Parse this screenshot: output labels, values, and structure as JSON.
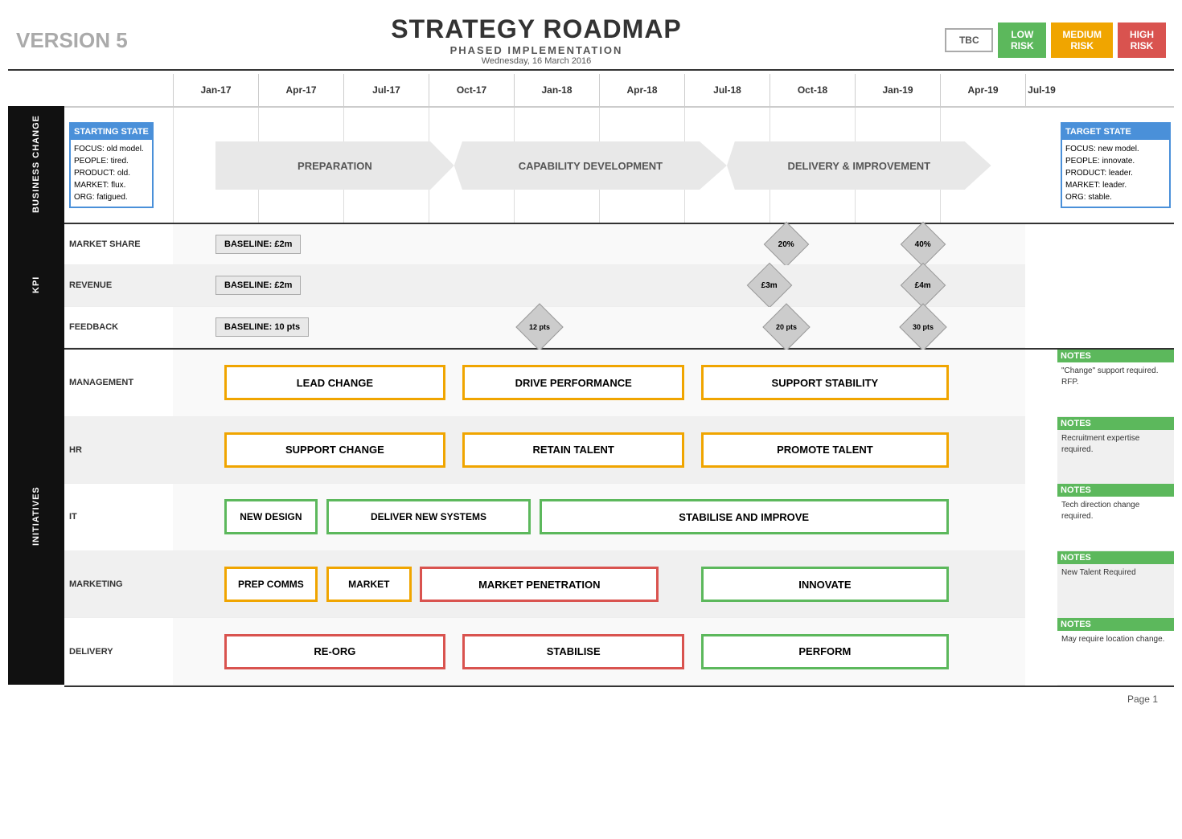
{
  "header": {
    "version": "VERSION 5",
    "title": "STRATEGY ROADMAP",
    "subtitle": "PHASED IMPLEMENTATION",
    "date": "Wednesday, 16 March 2016"
  },
  "badges": [
    {
      "label": "TBC",
      "class": "badge-tbc"
    },
    {
      "label": "LOW\nRISK",
      "class": "badge-low"
    },
    {
      "label": "MEDIUM\nRISK",
      "class": "badge-medium"
    },
    {
      "label": "HIGH\nRISK",
      "class": "badge-high"
    }
  ],
  "timeline": {
    "months": [
      "Jan-17",
      "Apr-17",
      "Jul-17",
      "Oct-17",
      "Jan-18",
      "Apr-18",
      "Jul-18",
      "Oct-18",
      "Jan-19",
      "Apr-19",
      "Jul-19"
    ]
  },
  "bc": {
    "label": "BUSINESS CHANGE",
    "starting_state": {
      "title": "STARTING STATE",
      "lines": [
        "FOCUS: old model.",
        "PEOPLE: tired.",
        "PRODUCT: old.",
        "MARKET: flux.",
        "ORG: fatigued."
      ]
    },
    "target_state": {
      "title": "TARGET STATE",
      "lines": [
        "FOCUS: new model.",
        "PEOPLE: innovate.",
        "PRODUCT: leader.",
        "MARKET: leader.",
        "ORG: stable."
      ]
    },
    "phases": [
      {
        "label": "PREPARATION",
        "start_pct": 9,
        "width_pct": 28
      },
      {
        "label": "CAPABILITY DEVELOPMENT",
        "start_pct": 37,
        "width_pct": 31
      },
      {
        "label": "DELIVERY & IMPROVEMENT",
        "start_pct": 68,
        "width_pct": 29
      }
    ]
  },
  "kpi": {
    "label": "KPI",
    "rows": [
      {
        "name": "MARKET SHARE",
        "baseline": {
          "label": "BASELINE: £2m",
          "pos_pct": 10
        },
        "milestones": [
          {
            "label": "20%",
            "pos_pct": 73,
            "type": "diamond"
          },
          {
            "label": "40%",
            "pos_pct": 89,
            "type": "diamond"
          }
        ]
      },
      {
        "name": "REVENUE",
        "baseline": {
          "label": "BASELINE: £2m",
          "pos_pct": 10
        },
        "milestones": [
          {
            "label": "£3m",
            "pos_pct": 71,
            "type": "diamond"
          },
          {
            "label": "£4m",
            "pos_pct": 89,
            "type": "diamond"
          }
        ]
      },
      {
        "name": "FEEDBACK",
        "baseline": {
          "label": "BASELINE: 10 pts",
          "pos_pct": 10
        },
        "milestones": [
          {
            "label": "12 pts",
            "pos_pct": 44,
            "type": "diamond"
          },
          {
            "label": "20 pts",
            "pos_pct": 73,
            "type": "diamond"
          },
          {
            "label": "30 pts",
            "pos_pct": 89,
            "type": "diamond"
          }
        ]
      }
    ]
  },
  "initiatives": {
    "label": "INITIATIVES",
    "rows": [
      {
        "name": "MANAGEMENT",
        "boxes": [
          {
            "label": "LEAD CHANGE",
            "start_pct": 6,
            "width_pct": 27,
            "color": "orange"
          },
          {
            "label": "DRIVE PERFORMANCE",
            "start_pct": 34,
            "width_pct": 27,
            "color": "orange"
          },
          {
            "label": "SUPPORT STABILITY",
            "start_pct": 62,
            "width_pct": 29,
            "color": "orange"
          }
        ],
        "notes": {
          "title": "NOTES",
          "text": "\"Change\" support required. RFP."
        }
      },
      {
        "name": "HR",
        "boxes": [
          {
            "label": "SUPPORT CHANGE",
            "start_pct": 6,
            "width_pct": 27,
            "color": "orange"
          },
          {
            "label": "RETAIN TALENT",
            "start_pct": 34,
            "width_pct": 27,
            "color": "orange"
          },
          {
            "label": "PROMOTE TALENT",
            "start_pct": 62,
            "width_pct": 29,
            "color": "orange"
          }
        ],
        "notes": {
          "title": "NOTES",
          "text": "Recruitment expertise required."
        }
      },
      {
        "name": "IT",
        "boxes": [
          {
            "label": "NEW DESIGN",
            "start_pct": 6,
            "width_pct": 12,
            "color": "green"
          },
          {
            "label": "DELIVER NEW SYSTEMS",
            "start_pct": 19,
            "width_pct": 24,
            "color": "green"
          },
          {
            "label": "STABILISE AND IMPROVE",
            "start_pct": 44,
            "width_pct": 47,
            "color": "green"
          }
        ],
        "notes": {
          "title": "NOTES",
          "text": "Tech direction change required."
        }
      },
      {
        "name": "MARKETING",
        "boxes": [
          {
            "label": "PREP COMMS",
            "start_pct": 6,
            "width_pct": 12,
            "color": "orange"
          },
          {
            "label": "MARKET",
            "start_pct": 19,
            "width_pct": 11,
            "color": "orange"
          },
          {
            "label": "MARKET PENETRATION",
            "start_pct": 31,
            "width_pct": 27,
            "color": "red"
          },
          {
            "label": "INNOVATE",
            "start_pct": 62,
            "width_pct": 29,
            "color": "green"
          }
        ],
        "notes": {
          "title": "NOTES",
          "text": "New Talent Required"
        }
      },
      {
        "name": "DELIVERY",
        "boxes": [
          {
            "label": "RE-ORG",
            "start_pct": 6,
            "width_pct": 27,
            "color": "red"
          },
          {
            "label": "STABILISE",
            "start_pct": 34,
            "width_pct": 27,
            "color": "red"
          },
          {
            "label": "PERFORM",
            "start_pct": 62,
            "width_pct": 29,
            "color": "green"
          }
        ],
        "notes": {
          "title": "NOTES",
          "text": "May require location change."
        }
      }
    ]
  },
  "page": {
    "number": "Page 1"
  }
}
